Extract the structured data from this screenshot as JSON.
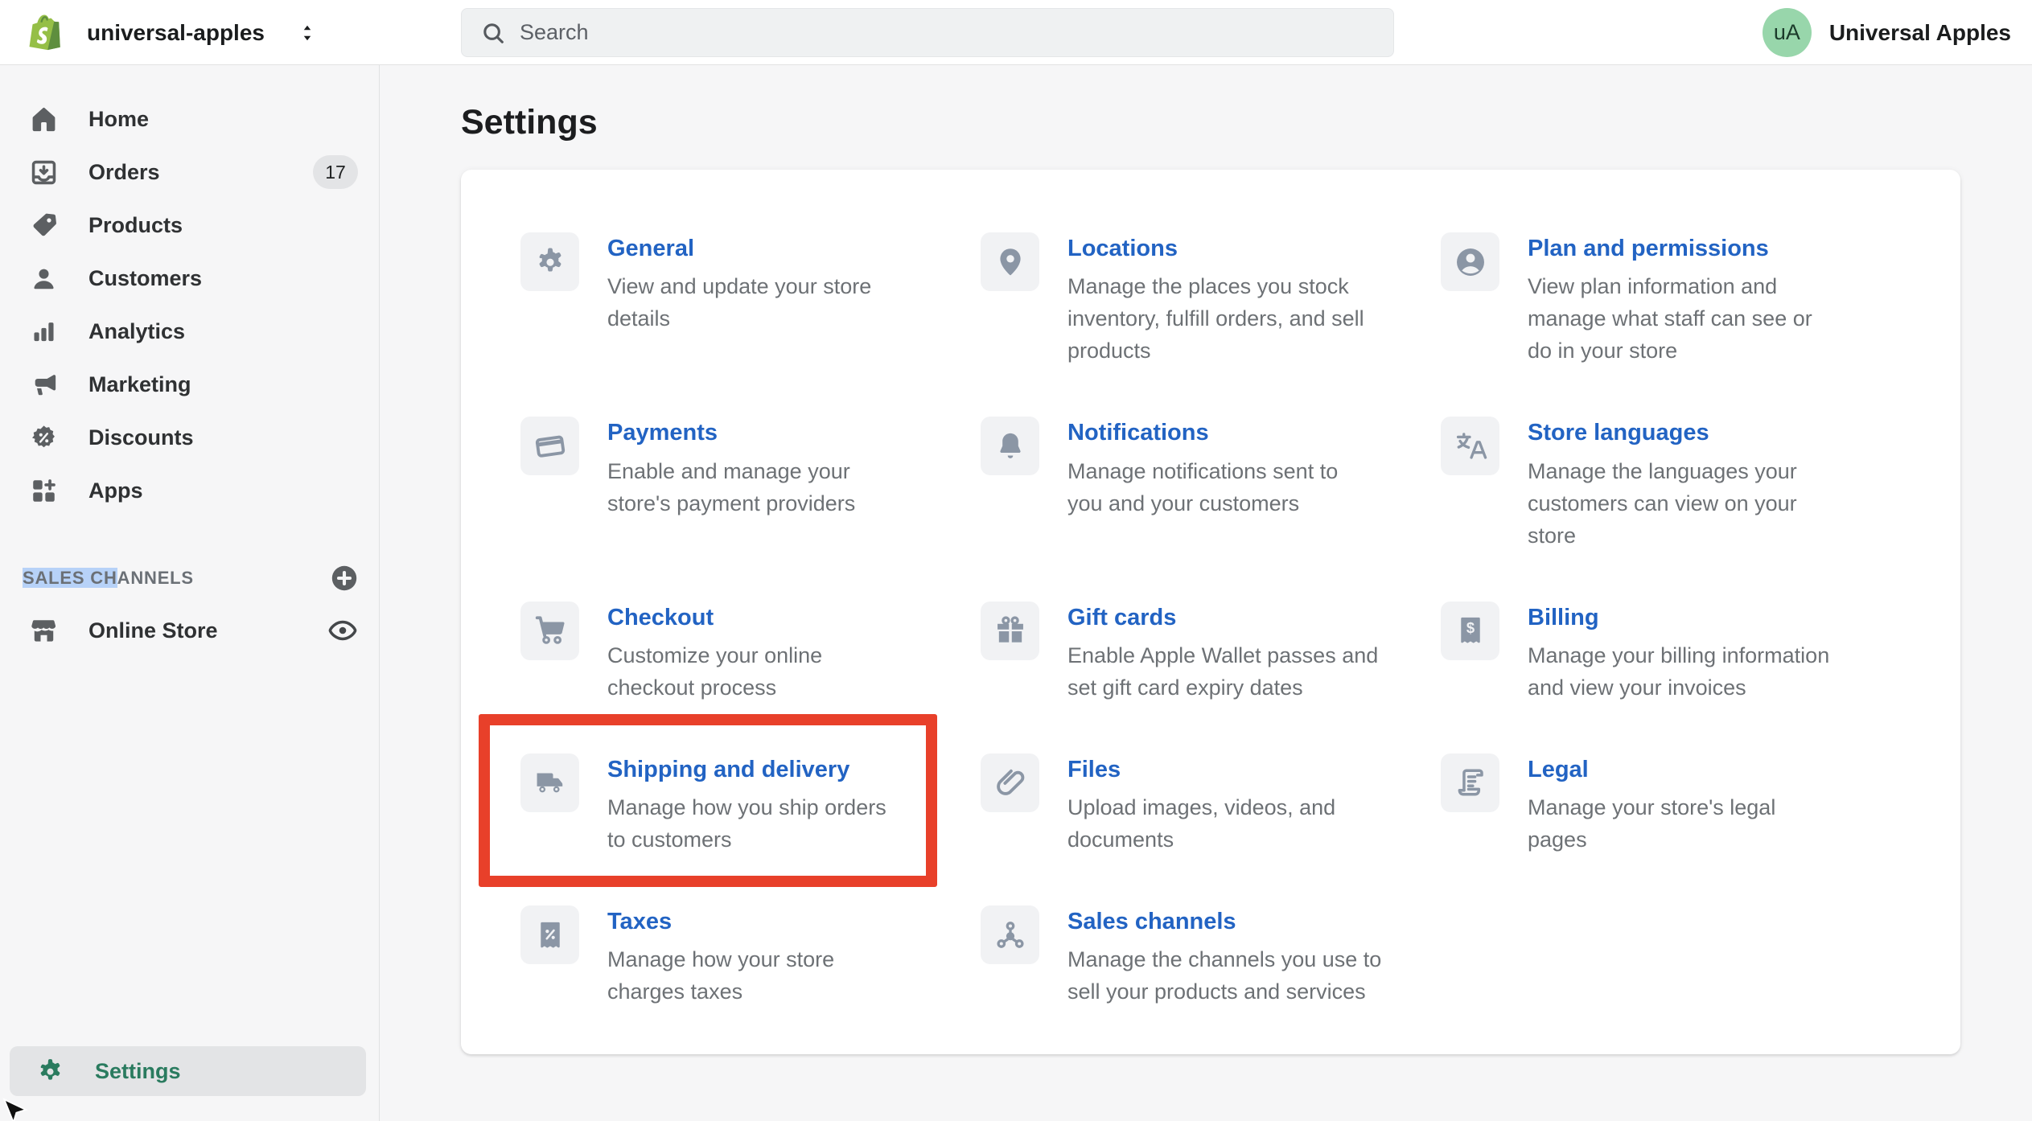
{
  "topbar": {
    "store_name": "universal-apples",
    "search_placeholder": "Search",
    "account_initials": "uA",
    "account_name": "Universal Apples"
  },
  "sidebar": {
    "items": [
      {
        "label": "Home",
        "icon": "home"
      },
      {
        "label": "Orders",
        "icon": "orders",
        "badge": "17"
      },
      {
        "label": "Products",
        "icon": "tag"
      },
      {
        "label": "Customers",
        "icon": "person"
      },
      {
        "label": "Analytics",
        "icon": "chart-bars"
      },
      {
        "label": "Marketing",
        "icon": "megaphone"
      },
      {
        "label": "Discounts",
        "icon": "discount-badge"
      },
      {
        "label": "Apps",
        "icon": "apps-grid"
      }
    ],
    "channels_label_selected": "SALES CH",
    "channels_label_rest": "ANNELS",
    "online_store_label": "Online Store",
    "settings_label": "Settings"
  },
  "main": {
    "title": "Settings",
    "tiles": [
      {
        "title": "General",
        "icon": "gear",
        "desc": "View and update your store details"
      },
      {
        "title": "Locations",
        "icon": "location-pin",
        "desc": "Manage the places you stock inventory, fulfill orders, and sell products"
      },
      {
        "title": "Plan and permissions",
        "icon": "person-circle",
        "desc": "View plan information and manage what staff can see or do in your store"
      },
      {
        "title": "Payments",
        "icon": "credit-card",
        "desc": "Enable and manage your store's payment providers"
      },
      {
        "title": "Notifications",
        "icon": "bell",
        "desc": "Manage notifications sent to you and your customers"
      },
      {
        "title": "Store languages",
        "icon": "translate",
        "desc": "Manage the languages your customers can view on your store"
      },
      {
        "title": "Checkout",
        "icon": "cart",
        "desc": "Customize your online checkout process"
      },
      {
        "title": "Gift cards",
        "icon": "gift",
        "desc": "Enable Apple Wallet passes and set gift card expiry dates"
      },
      {
        "title": "Billing",
        "icon": "receipt-dollar",
        "desc": "Manage your billing information and view your invoices"
      },
      {
        "title": "Shipping and delivery",
        "icon": "truck",
        "desc": "Manage how you ship orders to customers",
        "highlighted": true
      },
      {
        "title": "Files",
        "icon": "paperclip",
        "desc": "Upload images, videos, and documents"
      },
      {
        "title": "Legal",
        "icon": "legal-scroll",
        "desc": "Manage your store's legal pages"
      },
      {
        "title": "Taxes",
        "icon": "tax-receipt",
        "desc": "Manage how your store charges taxes"
      },
      {
        "title": "Sales channels",
        "icon": "share-nodes",
        "desc": "Manage the channels you use to sell your products and services"
      }
    ]
  },
  "colors": {
    "link_blue": "#2263c3",
    "highlight_red": "#e8402a",
    "brand_green": "#95bf47",
    "selected_green": "#2a7b5f",
    "avatar_green": "#98d6ab",
    "selection_blue": "#b7d2f8"
  }
}
